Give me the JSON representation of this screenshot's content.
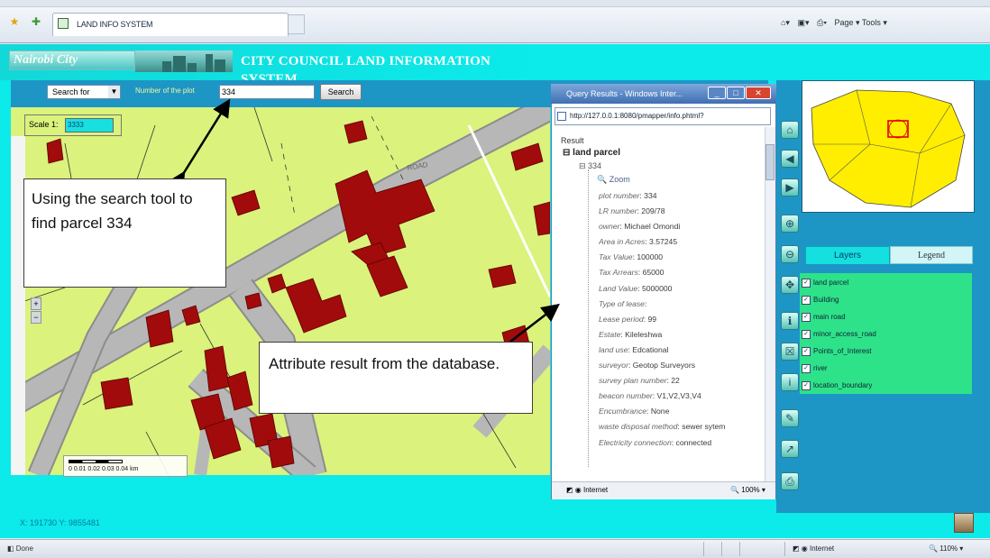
{
  "browser": {
    "tab_title": "LAND INFO SYSTEM",
    "toolbar_text": "Page ▾  Tools ▾",
    "status_text": "Done",
    "status_zone": "Internet",
    "status_zoom": "110%"
  },
  "app": {
    "logo_text": "Nairobi City",
    "title": "CITY COUNCIL LAND INFORMATION SYSTEM",
    "search": {
      "dropdown_value": "Search for",
      "plot_label": "Number of the plot",
      "plot_value": "334",
      "button_label": "Search"
    },
    "scale_label": "Scale 1:",
    "scale_value": "3333",
    "scalebar_text": "0  0.01 0.02 0.03 0.04 km",
    "road_label": "ROAD",
    "coords": "X: 191730   Y: 9855481"
  },
  "popup": {
    "title": "Query Results - Windows Inter...",
    "address": "http://127.0.0.1:8080/pmapper/info.phtml?",
    "result_label": "Result",
    "tree_label": "land parcel",
    "parcel_id": "334",
    "zoom_label": "Zoom",
    "attributes": [
      {
        "key": "plot number",
        "value": "334"
      },
      {
        "key": "LR number",
        "value": "209/78"
      },
      {
        "key": "owner",
        "value": "Michael Omondi"
      },
      {
        "key": "Area in Acres",
        "value": "3.57245"
      },
      {
        "key": "Tax Value",
        "value": "100000"
      },
      {
        "key": "Tax Arrears",
        "value": "65000"
      },
      {
        "key": "Land Value",
        "value": "5000000"
      },
      {
        "key": "Type of lease",
        "value": ""
      },
      {
        "key": "Lease period",
        "value": "99"
      },
      {
        "key": "Estate",
        "value": "Kileleshwa"
      },
      {
        "key": "land use",
        "value": "Edcational"
      },
      {
        "key": "surveyor",
        "value": "Geotop Surveyors"
      },
      {
        "key": "survey plan number",
        "value": "22"
      },
      {
        "key": "beacon number",
        "value": "V1,V2,V3,V4"
      },
      {
        "key": "Encumbrance",
        "value": "None"
      },
      {
        "key": "waste disposal method",
        "value": "sewer sytem"
      },
      {
        "key": "Electricity connection",
        "value": "connected"
      }
    ],
    "status_zone": "Internet",
    "status_zoom": "100%"
  },
  "right": {
    "layers_tab": "Layers",
    "legend_tab": "Legend",
    "layers": [
      "land parcel",
      "Building",
      "main road",
      "minor_access_road",
      "Points_of_Interest",
      "river",
      "location_boundary"
    ]
  },
  "annotations": {
    "search_callout": "Using the search tool to find parcel 334",
    "attribute_callout": "Attribute result from the database."
  },
  "colors": {
    "app_background": "#0ceaea",
    "panel_blue": "#1d96c6",
    "map_land": "#dbf27c",
    "building_red": "#a10b0b",
    "road_gray": "#b3b3b3",
    "layers_green": "#2ee28a",
    "overview_yellow": "#ffee00"
  }
}
